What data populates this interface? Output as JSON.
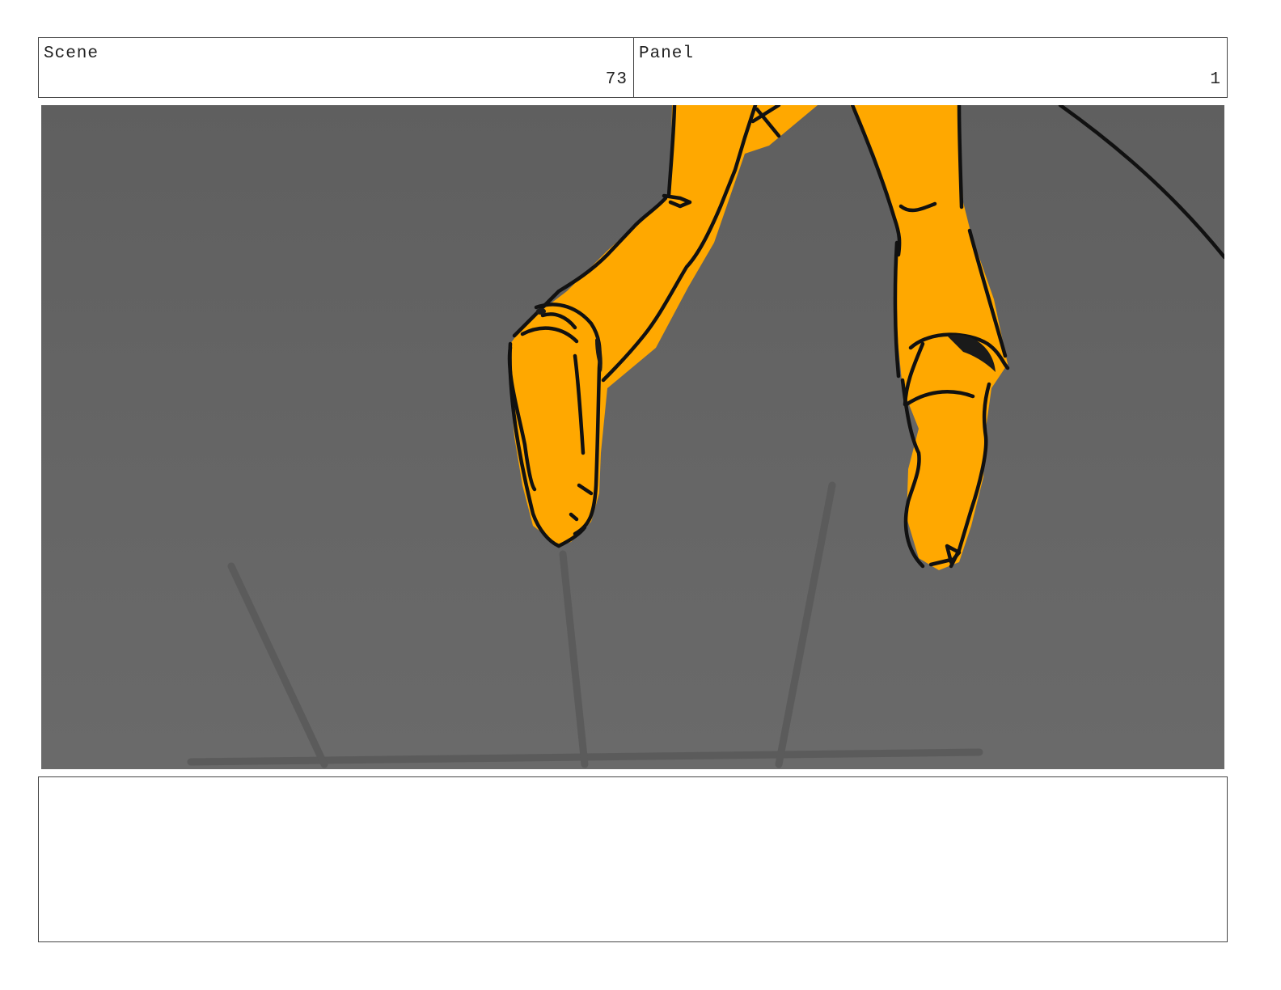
{
  "header": {
    "scene_label": "Scene",
    "scene_value": "73",
    "panel_label": "Panel",
    "panel_value": "1"
  },
  "drawing": {
    "background_color": "#636363",
    "figure_fill": "#FFA800",
    "ink_color": "#111111",
    "shadow_line_color": "#5a5a5a"
  },
  "notes": {
    "text": ""
  }
}
